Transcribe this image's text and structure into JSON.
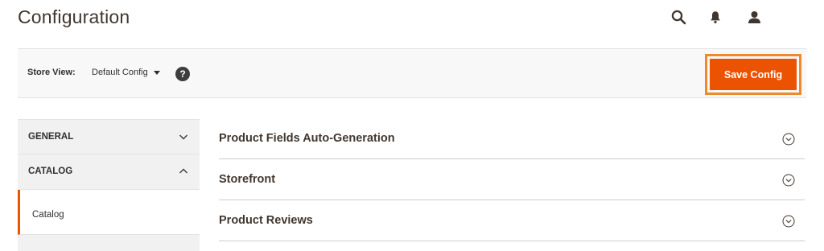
{
  "header": {
    "title": "Configuration",
    "icons": [
      "search-icon",
      "notifications-bell-icon",
      "user-account-icon"
    ]
  },
  "toolbar": {
    "store_view_label": "Store View:",
    "store_view_value": "Default Config",
    "help_icon": "?",
    "save_label": "Save Config"
  },
  "sidebar": {
    "sections": [
      {
        "label": "GENERAL",
        "state": "collapsed"
      },
      {
        "label": "CATALOG",
        "state": "expanded"
      }
    ],
    "active_item": {
      "label": "Catalog"
    }
  },
  "main": {
    "sections": [
      {
        "label": "Product Fields Auto-Generation"
      },
      {
        "label": "Storefront"
      },
      {
        "label": "Product Reviews"
      }
    ]
  },
  "colors": {
    "accent": "#eb5202",
    "highlight_frame": "#f0892b",
    "sidebar_bg": "#f1f1f1",
    "toolbar_bg": "#f8f8f8",
    "text": "#303030",
    "title": "#41362f"
  }
}
